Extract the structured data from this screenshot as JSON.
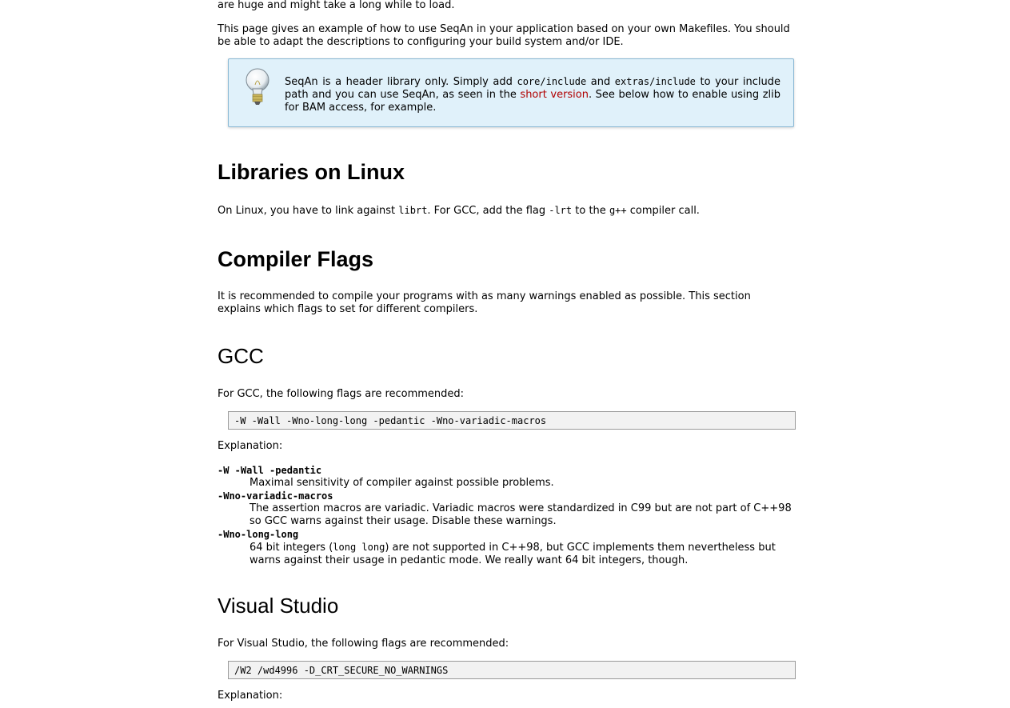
{
  "intro": {
    "top_line": "are huge and might take a long while to load.",
    "para": "This page gives an example of how to use SeqAn in your application based on your own Makefiles. You should be able to adapt the descriptions to configuring your build system and/or IDE."
  },
  "tip": {
    "icon": "lightbulb-icon",
    "t1": "SeqAn is a header library only. Simply add ",
    "code1": "core/include",
    "t2": " and ",
    "code2": "extras/include",
    "t3": " to your include path and you can use SeqAn, as seen in the ",
    "link": "short version",
    "t4": ". See below how to enable using zlib for BAM access, for example."
  },
  "linux": {
    "heading": "Libraries on Linux",
    "t1": "On Linux, you have to link against ",
    "code1": "librt",
    "t2": ". For GCC, add the flag ",
    "code2": "-lrt",
    "t3": " to the ",
    "code3": "g++",
    "t4": " compiler call."
  },
  "compiler_flags": {
    "heading": "Compiler Flags",
    "para": "It is recommended to compile your programs with as many warnings enabled as possible. This section explains which flags to set for different compilers."
  },
  "gcc": {
    "heading": "GCC",
    "intro": "For GCC, the following flags are recommended:",
    "code": "-W -Wall -Wno-long-long -pedantic -Wno-variadic-macros",
    "explanation": "Explanation:",
    "items": [
      {
        "term": "-W -Wall -pedantic",
        "desc": "Maximal sensitivity of compiler against possible problems."
      },
      {
        "term": "-Wno-variadic-macros",
        "desc": "The assertion macros are variadic. Variadic macros were standardized in C99 but are not part of C++98 so GCC warns against their usage. Disable these warnings."
      },
      {
        "term": "-Wno-long-long",
        "d1": "64 bit integers (",
        "dcode": "long long",
        "d2": ") are not supported in C++98, but GCC implements them nevertheless but warns against their usage in pedantic mode. We really want 64 bit integers, though."
      }
    ]
  },
  "vs": {
    "heading": "Visual Studio",
    "intro": "For Visual Studio, the following flags are recommended:",
    "code": "/W2 /wd4996 -D_CRT_SECURE_NO_WARNINGS",
    "explanation": "Explanation:"
  }
}
